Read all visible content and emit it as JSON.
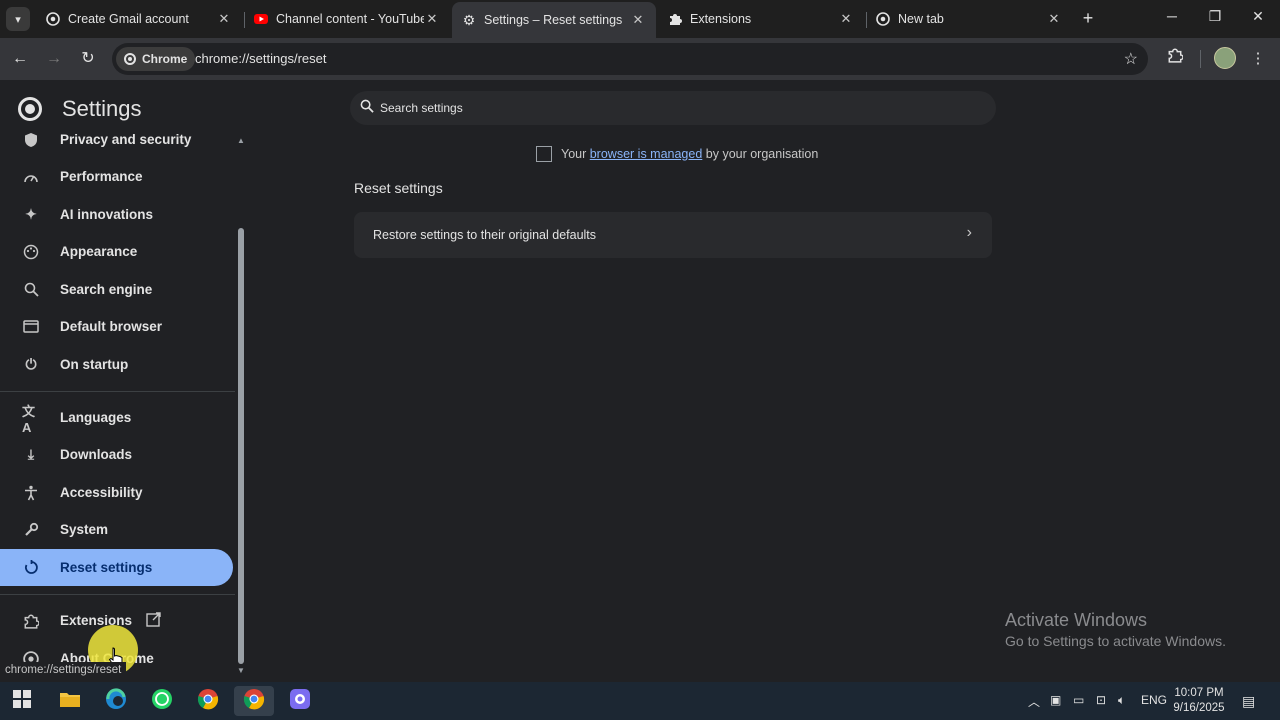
{
  "browser": {
    "tabs": [
      {
        "label": "Create Gmail account",
        "icon": "chrome-icon"
      },
      {
        "label": "Channel content - YouTube S",
        "icon": "youtube-icon"
      },
      {
        "label": "Settings – Reset settings",
        "icon": "gear-icon",
        "active": true
      },
      {
        "label": "Extensions",
        "icon": "puzzle-icon"
      },
      {
        "label": "New tab",
        "icon": "chrome-icon"
      }
    ],
    "chip_label": "Chrome",
    "url": "chrome://settings/reset"
  },
  "sidebar": {
    "title": "Settings",
    "items": [
      {
        "label": "Privacy and security",
        "icon": "shield-icon"
      },
      {
        "label": "Performance",
        "icon": "speedometer-icon"
      },
      {
        "label": "AI innovations",
        "icon": "sparkle-icon"
      },
      {
        "label": "Appearance",
        "icon": "palette-icon"
      },
      {
        "label": "Search engine",
        "icon": "search-icon"
      },
      {
        "label": "Default browser",
        "icon": "browser-window-icon"
      },
      {
        "label": "On startup",
        "icon": "power-icon"
      },
      {
        "label": "Languages",
        "icon": "translate-icon"
      },
      {
        "label": "Downloads",
        "icon": "download-icon"
      },
      {
        "label": "Accessibility",
        "icon": "accessibility-icon"
      },
      {
        "label": "System",
        "icon": "wrench-icon"
      },
      {
        "label": "Reset settings",
        "icon": "reset-icon",
        "selected": true
      },
      {
        "label": "Extensions",
        "icon": "puzzle-icon"
      },
      {
        "label": "About Chrome",
        "icon": "chrome-icon"
      }
    ]
  },
  "main": {
    "search_placeholder": "Search settings",
    "managed_prefix": "Your ",
    "managed_link": "browser is managed",
    "managed_suffix": " by your organisation",
    "section_title": "Reset settings",
    "card_label": "Restore settings to their original defaults"
  },
  "watermark": {
    "line1": "Activate Windows",
    "line2": "Go to Settings to activate Windows."
  },
  "status_url": "chrome://settings/reset",
  "taskbar": {
    "lang": "ENG",
    "time": "10:07 PM",
    "date": "9/16/2025"
  },
  "colors": {
    "accent": "#8ab4f8",
    "background": "#202124"
  }
}
